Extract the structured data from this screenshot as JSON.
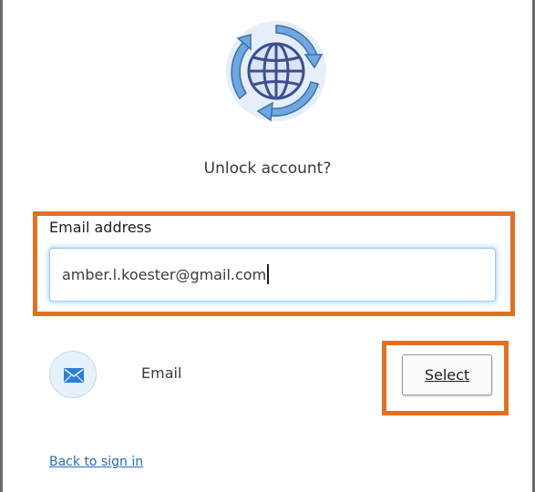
{
  "title": "Unlock account?",
  "email": {
    "label": "Email address",
    "value": "amber.l.koester@gmail.com"
  },
  "factor": {
    "icon": "envelope-icon",
    "label": "Email",
    "select_label": "Select"
  },
  "back_link": "Back to sign in",
  "logo": "globe-arrows-icon",
  "colors": {
    "highlight": "#e07028",
    "link": "#1f6fbf",
    "logo_ring": "#5b9bd6",
    "logo_globe": "#3d4f8f"
  }
}
